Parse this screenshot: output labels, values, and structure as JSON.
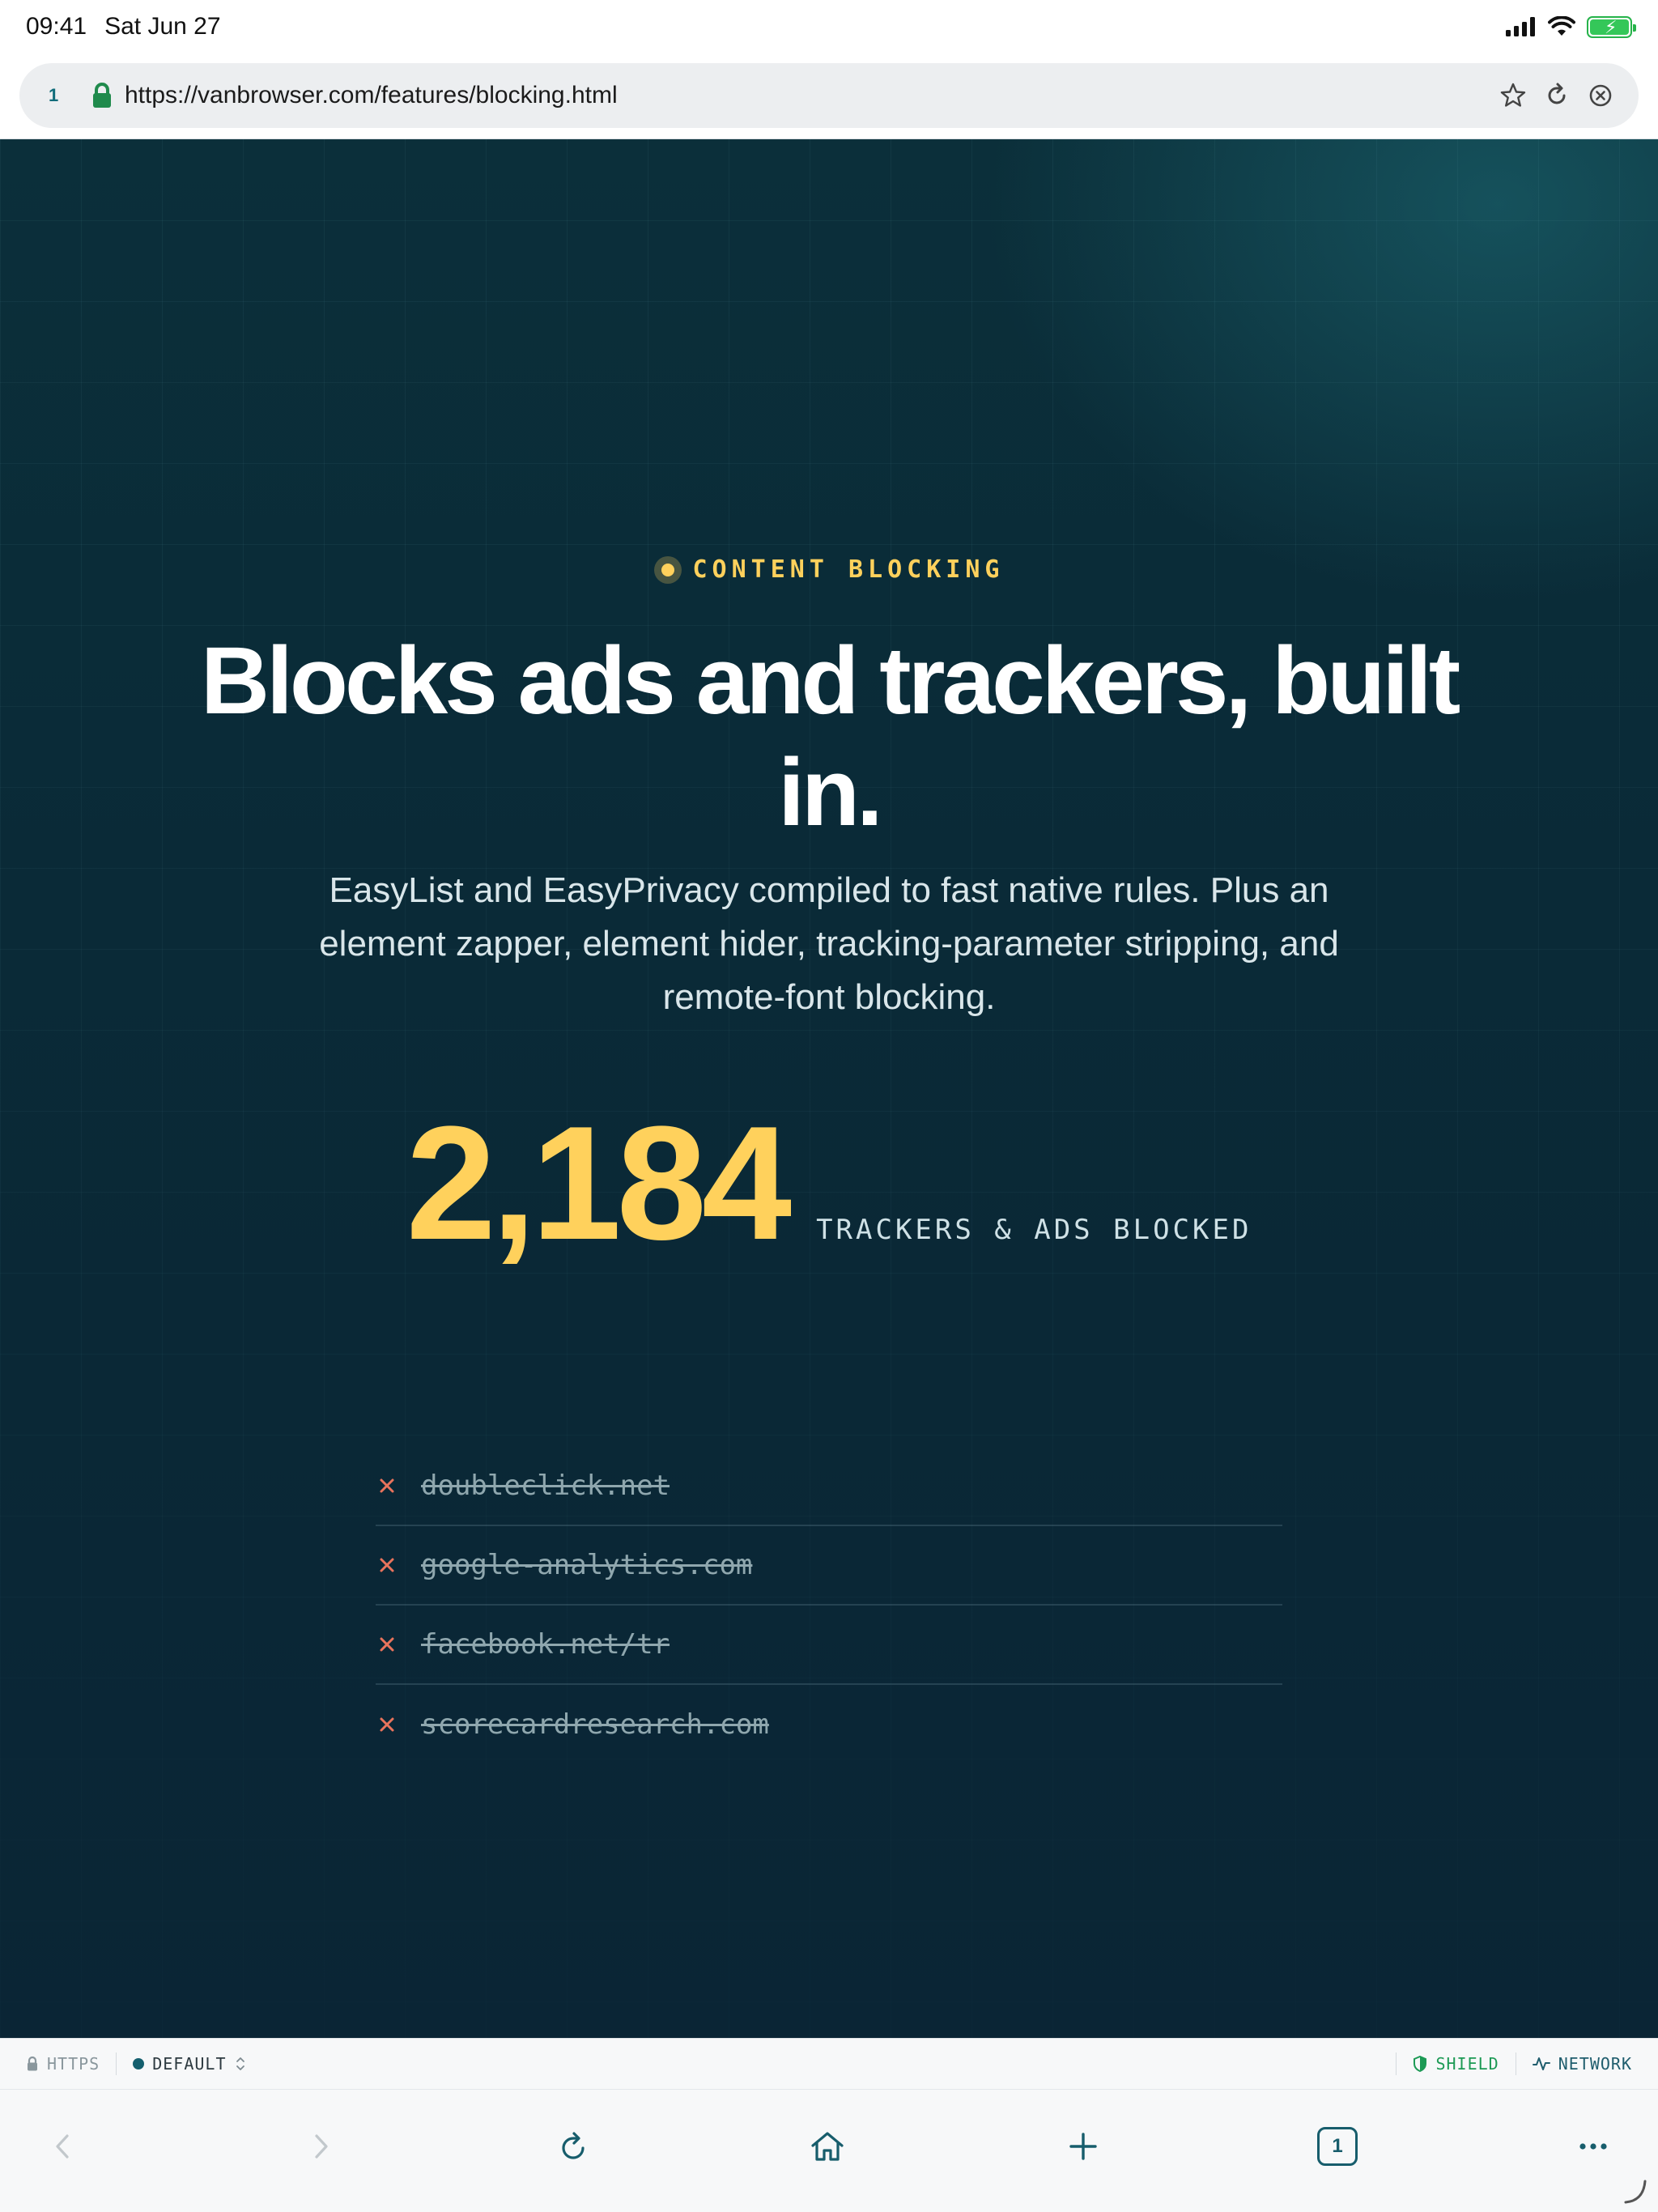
{
  "status_bar": {
    "time": "09:41",
    "date": "Sat Jun 27"
  },
  "browser": {
    "tab_count": "1",
    "url": "https://vanbrowser.com/features/blocking.html"
  },
  "hero": {
    "eyebrow": "CONTENT BLOCKING",
    "title": "Blocks ads and trackers, built in.",
    "subtitle": "EasyList and EasyPrivacy compiled to fast native rules. Plus an element zapper, element hider, tracking-parameter stripping, and remote-font blocking.",
    "stat_value": "2,184",
    "stat_label": "TRACKERS & ADS BLOCKED",
    "blocked": [
      "doubleclick.net",
      "google-analytics.com",
      "facebook.net/tr",
      "scorecardresearch.com"
    ]
  },
  "info_strip": {
    "https_label": "HTTPS",
    "profile_label": "DEFAULT",
    "shield_label": "SHIELD",
    "network_label": "NETWORK"
  },
  "toolbar": {
    "tabs_count": "1"
  },
  "colors": {
    "accent_yellow": "#ffd15c",
    "hero_bg": "#0a2a37",
    "teal": "#175d6c",
    "blocked_x": "#e8735c",
    "shield_green": "#1d9a55"
  }
}
